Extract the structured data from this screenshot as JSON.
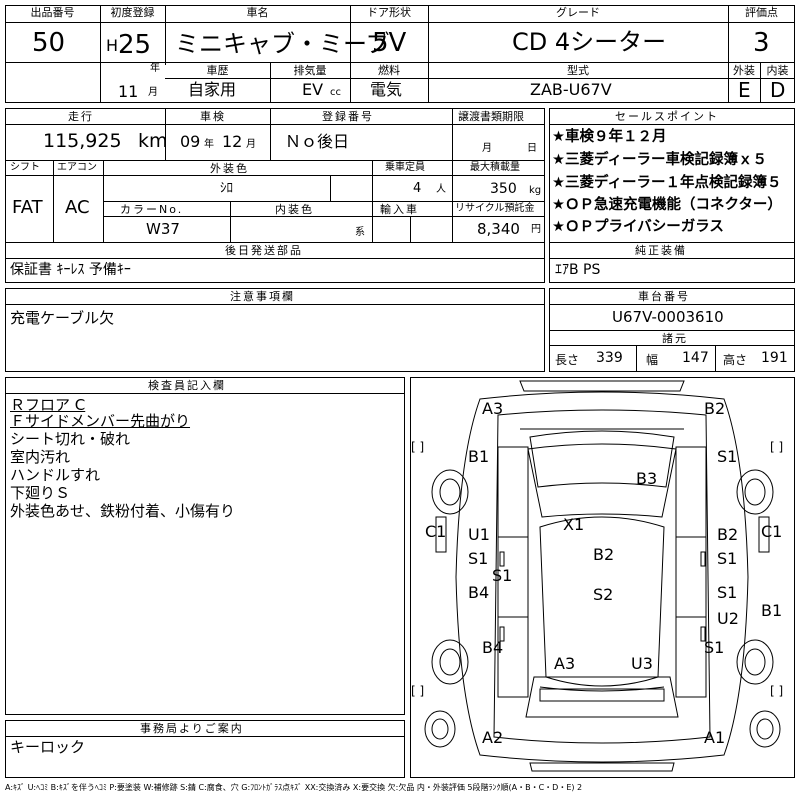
{
  "top": {
    "lot_label": "出品番号",
    "lot_no": "50",
    "first_reg_label": "初度登録",
    "era": "H",
    "year": "25",
    "year_unit": "年",
    "month": "11",
    "month_unit": "月",
    "car_name_label": "車名",
    "car_name": "ミニキャブ・ミーブ",
    "door_label": "ドア形状",
    "door": "5V",
    "grade_label": "グレード",
    "grade": "CD 4シーター",
    "score_label": "評価点",
    "score": "3",
    "history_label": "車歴",
    "history": "自家用",
    "displacement_label": "排気量",
    "displacement": "EV",
    "cc_unit": "cc",
    "fuel_label": "燃料",
    "fuel": "電気",
    "model_label": "型式",
    "model": "ZAB-U67V",
    "ext_label": "外装",
    "int_label": "内装",
    "ext_grade": "E",
    "int_grade": "D"
  },
  "row2": {
    "mileage_label": "走行",
    "mileage": "115,925",
    "km_unit": "km",
    "inspection_label": "車検",
    "insp_year": "09",
    "insp_year_unit": "年",
    "insp_month": "12",
    "insp_month_unit": "月",
    "reg_no_label": "登録番号",
    "reg_no": "Ｎｏ後日",
    "transfer_label": "譲渡書類期限",
    "transfer_month_unit": "月",
    "transfer_day_unit": "日",
    "sales_label": "セールスポイント",
    "sales_points": [
      "★車検９年１２月",
      "★三菱ディーラー車検記録簿ｘ５",
      "★三菱ディーラー１年点検記録簿５",
      "★ＯＰ急速充電機能（コネクター）",
      "★ＯＰプライバシーガラス"
    ]
  },
  "row3": {
    "shift_label": "シフト",
    "shift": "FAT",
    "ac_label": "エアコン",
    "ac": "AC",
    "color_label": "外装色",
    "color": "ｼﾛ",
    "capacity_label": "乗車定員",
    "capacity": "4",
    "capacity_unit": "人",
    "load_label": "最大積載量",
    "load": "350",
    "load_unit": "kg",
    "color_no_label": "カラーNo.",
    "color_no": "W37",
    "interior_label": "内装色",
    "interior_unit": "系",
    "import_label": "輸入車",
    "recycle_label": "リサイクル預託金",
    "recycle": "8,340",
    "recycle_unit": "円"
  },
  "accessories": {
    "label": "後日発送部品",
    "value": "保証書 ｷｰﾚｽ 予備ｷｰ"
  },
  "equipment": {
    "label": "純正装備",
    "value": "ｴｱB PS"
  },
  "notes": {
    "label": "注意事項欄",
    "value": "充電ケーブル欠"
  },
  "chassis": {
    "label": "車台番号",
    "value": "U67V-0003610"
  },
  "specs": {
    "label": "諸元",
    "length_label": "長さ",
    "length": "339",
    "width_label": "幅",
    "width": "147",
    "height_label": "高さ",
    "height": "191"
  },
  "inspector": {
    "label": "検査員記入欄",
    "lines": [
      "Ｒフロア C",
      "Ｆサイドメンバー先曲がり",
      "シート切れ・破れ",
      "室内汚れ",
      "ハンドルすれ",
      "下廻りＳ",
      "外装色あせ、鉄粉付着、小傷有り"
    ]
  },
  "office": {
    "label": "事務局よりご案内",
    "value": "キーロック"
  },
  "diagram_marks": {
    "a3_top": "A3",
    "b2_top": "B2",
    "b1_l": "B1",
    "s1_r_top": "S1",
    "b3": "B3",
    "c1_l": "C1",
    "c1_r": "C1",
    "x1": "X1",
    "u1": "U1",
    "s1_l1": "S1",
    "s1_c": "S1",
    "b2_c": "B2",
    "b2_r": "B2",
    "s1_r2": "S1",
    "b4_l1": "B4",
    "s2": "S2",
    "s1_r3": "S1",
    "u2": "U2",
    "b1_r": "B1",
    "b4_l2": "B4",
    "s1_r4": "S1",
    "a3_bot": "A3",
    "u3": "U3",
    "a2": "A2",
    "a1": "A1",
    "bracket": "[ ]"
  },
  "legend": "A:ｷｽﾞ U:ﾍｺﾐ B:ｷｽﾞを伴うﾍｺﾐ P:要塗装 W:補修跡 S:錆 C:腐食、穴 G:ﾌﾛﾝﾄｶﾞﾗｽ点ｷｽﾞ XX:交換済み X:要交換 欠:欠品 内・外装評価 5段階ﾗﾝｸ順(A・B・C・D・E) 2"
}
